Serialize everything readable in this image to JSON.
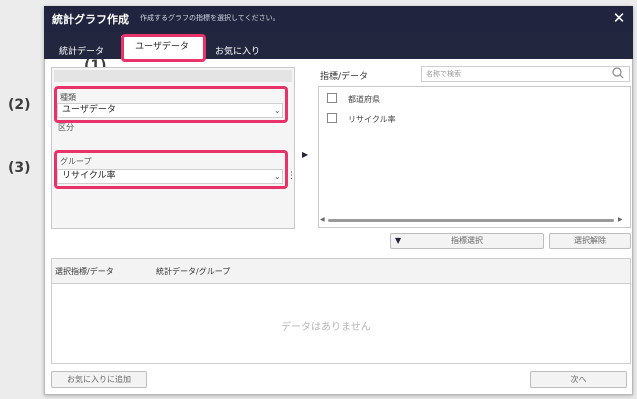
{
  "window": {
    "title": "統計グラフ作成",
    "subtitle": "作成するグラフの指標を選択してください。",
    "close_label": "✕"
  },
  "tabs": [
    {
      "label": "統計データ",
      "active": false
    },
    {
      "label": "ユーザデータ",
      "active": true
    },
    {
      "label": "お気に入り",
      "active": false
    }
  ],
  "callouts": {
    "c1": "(1)",
    "c2": "(2)",
    "c3": "(3)"
  },
  "left_panel": {
    "type_label": "種類",
    "type_value": "ユーザデータ",
    "category_label": "区分",
    "group_label": "グループ",
    "group_value": "リサイクル率"
  },
  "right_panel": {
    "title": "指標/データ",
    "search_placeholder": "名称で検索",
    "items": [
      {
        "label": "都道府県"
      },
      {
        "label": "リサイクル率"
      }
    ],
    "select_all_label": "指標選択",
    "deselect_label": "選択解除"
  },
  "bottom": {
    "col1": "選択指標/データ",
    "col2": "統計データ/グループ",
    "empty_message": "データはありません"
  },
  "footer": {
    "add_favorite_label": "お気に入りに追加",
    "next_label": "次へ"
  },
  "colors": {
    "titlebar": "#20243e",
    "highlight": "#e8326a"
  }
}
